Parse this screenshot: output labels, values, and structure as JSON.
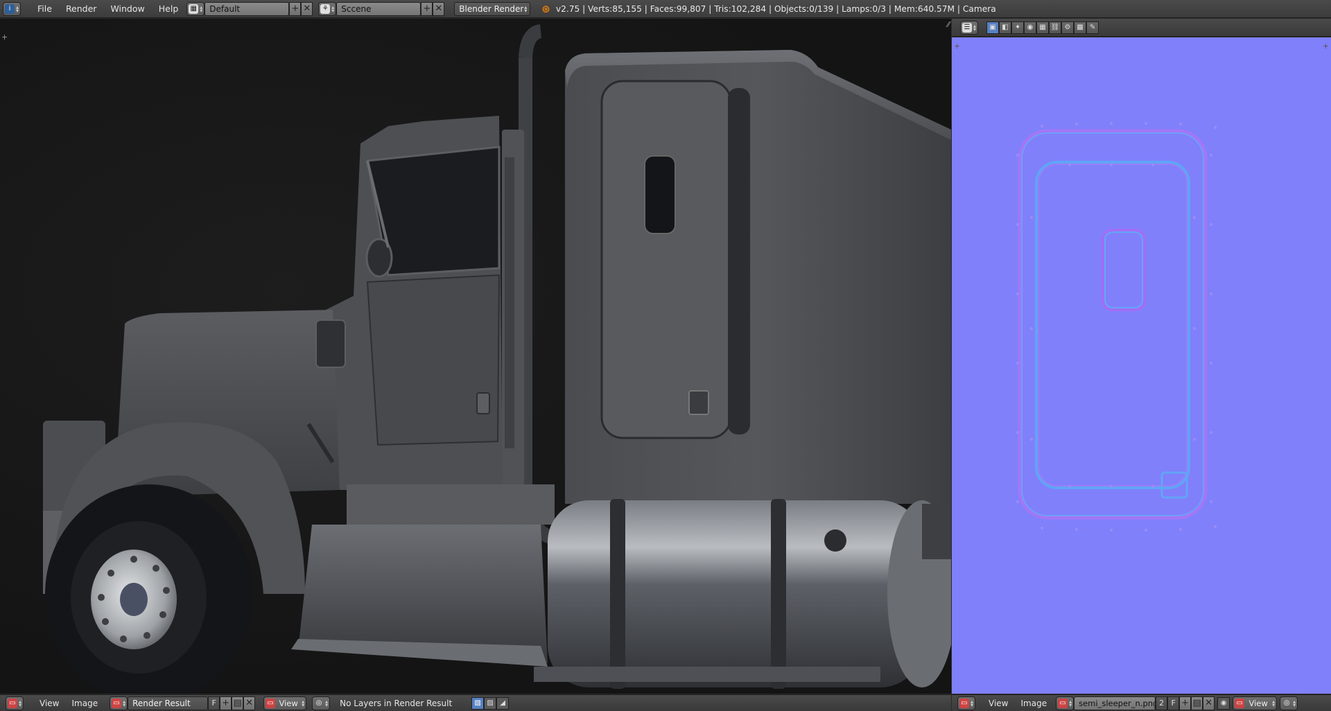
{
  "top_header": {
    "menus": [
      "File",
      "Render",
      "Window",
      "Help"
    ],
    "screen_layout": "Default",
    "scene": "Sccene",
    "render_engine": "Blender Render",
    "stats": "v2.75 | Verts:85,155 | Faces:99,807 | Tris:102,284 | Objects:0/139 | Lamps:0/3 | Mem:640.57M | Camera"
  },
  "left_bottom_header": {
    "menus": [
      "View",
      "Image"
    ],
    "image_name": "Render Result",
    "fake_user_label": "F",
    "view_label": "View",
    "layers_note": "No Layers in Render Result"
  },
  "right_bottom_header": {
    "menus": [
      "View",
      "Image"
    ],
    "image_name": "semi_sleeper_n.png",
    "users_count": "2",
    "fake_user_label": "F",
    "view_label": "View"
  },
  "colors": {
    "header_bg": "#3c3c3c",
    "viewport_bg": "#151515",
    "normal_map_base": "#8080fb",
    "blender_orange": "#e87d0d"
  },
  "icons": {
    "info": "info-icon",
    "layout": "screen-layout-icon",
    "scene": "scene-icon",
    "add": "plus-icon",
    "close": "close-x-icon",
    "blender_logo": "blender-logo-icon",
    "image_editor": "image-editor-icon"
  }
}
